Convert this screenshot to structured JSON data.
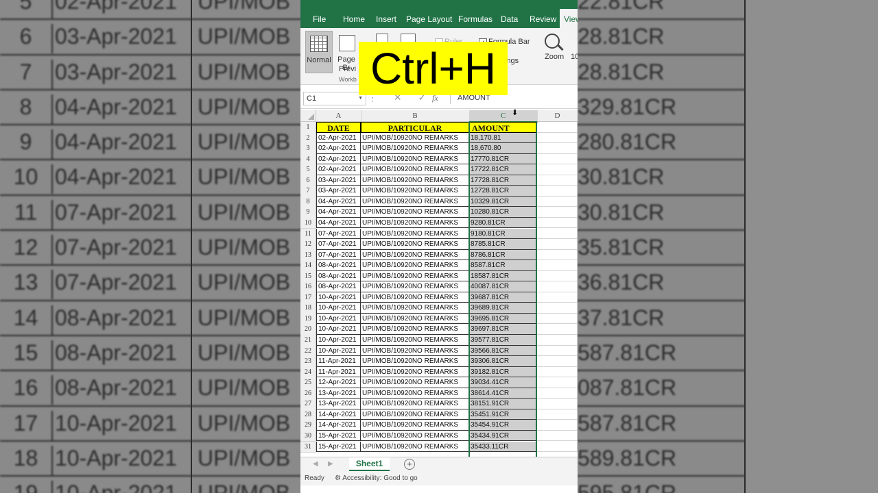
{
  "background": {
    "rows": [
      {
        "num": "5",
        "date": "02-Apr-2021",
        "part": "UPI/MOB",
        "amt": "22.81CR"
      },
      {
        "num": "6",
        "date": "03-Apr-2021",
        "part": "UPI/MOB",
        "amt": "28.81CR"
      },
      {
        "num": "7",
        "date": "03-Apr-2021",
        "part": "UPI/MOB",
        "amt": "28.81CR"
      },
      {
        "num": "8",
        "date": "04-Apr-2021",
        "part": "UPI/MOB",
        "amt": "329.81CR"
      },
      {
        "num": "9",
        "date": "04-Apr-2021",
        "part": "UPI/MOB",
        "amt": "280.81CR"
      },
      {
        "num": "10",
        "date": "04-Apr-2021",
        "part": "UPI/MOB",
        "amt": "30.81CR"
      },
      {
        "num": "11",
        "date": "07-Apr-2021",
        "part": "UPI/MOB",
        "amt": "30.81CR"
      },
      {
        "num": "12",
        "date": "07-Apr-2021",
        "part": "UPI/MOB",
        "amt": "35.81CR"
      },
      {
        "num": "13",
        "date": "07-Apr-2021",
        "part": "UPI/MOB",
        "amt": "36.81CR"
      },
      {
        "num": "14",
        "date": "08-Apr-2021",
        "part": "UPI/MOB",
        "amt": "37.81CR"
      },
      {
        "num": "15",
        "date": "08-Apr-2021",
        "part": "UPI/MOB",
        "amt": "587.81CR"
      },
      {
        "num": "16",
        "date": "08-Apr-2021",
        "part": "UPI/MOB",
        "amt": "087.81CR"
      },
      {
        "num": "17",
        "date": "10-Apr-2021",
        "part": "UPI/MOB",
        "amt": "587.81CR"
      },
      {
        "num": "18",
        "date": "10-Apr-2021",
        "part": "UPI/MOB",
        "amt": "589.81CR"
      },
      {
        "num": "19",
        "date": "10-Apr-2021",
        "part": "UPI/MOB",
        "amt": "595.81CR"
      }
    ]
  },
  "ribbon": {
    "tabs": [
      "File",
      "Home",
      "Insert",
      "Page Layout",
      "Formulas",
      "Data",
      "Review",
      "View"
    ],
    "active_tab": "View",
    "normal_label": "Normal",
    "page_break_label": "Page Br",
    "page_break_label2": "Previ",
    "workbook_group": "Workb",
    "ruler_label": "Ruler",
    "formula_bar_label": "Formula Bar",
    "headings_label": "ings",
    "zoom_label": "Zoom",
    "zoom100_label": "10"
  },
  "overlay": {
    "text": "Ctrl+H"
  },
  "formula_bar": {
    "name_box": "C1",
    "fx": "fx",
    "content": "AMOUNT"
  },
  "columns": [
    "A",
    "B",
    "C",
    "D"
  ],
  "headers": {
    "a": "DATE",
    "b": "PARTICULAR",
    "c": "AMOUNT"
  },
  "rows": [
    {
      "n": "1"
    },
    {
      "n": "2",
      "a": "02-Apr-2021",
      "b": "UPI/MOB/10920NO REMARKS",
      "c": "18,170.81"
    },
    {
      "n": "3",
      "a": "02-Apr-2021",
      "b": "UPI/MOB/10920NO REMARKS",
      "c": "18,670.80"
    },
    {
      "n": "4",
      "a": "02-Apr-2021",
      "b": "UPI/MOB/10920NO REMARKS",
      "c": "17770.81CR"
    },
    {
      "n": "5",
      "a": "02-Apr-2021",
      "b": "UPI/MOB/10920NO REMARKS",
      "c": "17722.81CR"
    },
    {
      "n": "6",
      "a": "03-Apr-2021",
      "b": "UPI/MOB/10920NO REMARKS",
      "c": "17728.81CR"
    },
    {
      "n": "7",
      "a": "03-Apr-2021",
      "b": "UPI/MOB/10920NO REMARKS",
      "c": "12728.81CR"
    },
    {
      "n": "8",
      "a": "04-Apr-2021",
      "b": "UPI/MOB/10920NO REMARKS",
      "c": "10329.81CR"
    },
    {
      "n": "9",
      "a": "04-Apr-2021",
      "b": "UPI/MOB/10920NO REMARKS",
      "c": "10280.81CR"
    },
    {
      "n": "10",
      "a": "04-Apr-2021",
      "b": "UPI/MOB/10920NO REMARKS",
      "c": "9280.81CR"
    },
    {
      "n": "11",
      "a": "07-Apr-2021",
      "b": "UPI/MOB/10920NO REMARKS",
      "c": "9180.81CR"
    },
    {
      "n": "12",
      "a": "07-Apr-2021",
      "b": "UPI/MOB/10920NO REMARKS",
      "c": "8785.81CR"
    },
    {
      "n": "13",
      "a": "07-Apr-2021",
      "b": "UPI/MOB/10920NO REMARKS",
      "c": "8786.81CR"
    },
    {
      "n": "14",
      "a": "08-Apr-2021",
      "b": "UPI/MOB/10920NO REMARKS",
      "c": "8587.81CR"
    },
    {
      "n": "15",
      "a": "08-Apr-2021",
      "b": "UPI/MOB/10920NO REMARKS",
      "c": "18587.81CR"
    },
    {
      "n": "16",
      "a": "08-Apr-2021",
      "b": "UPI/MOB/10920NO REMARKS",
      "c": "40087.81CR"
    },
    {
      "n": "17",
      "a": "10-Apr-2021",
      "b": "UPI/MOB/10920NO REMARKS",
      "c": "39687.81CR"
    },
    {
      "n": "18",
      "a": "10-Apr-2021",
      "b": "UPI/MOB/10920NO REMARKS",
      "c": "39689.81CR"
    },
    {
      "n": "19",
      "a": "10-Apr-2021",
      "b": "UPI/MOB/10920NO REMARKS",
      "c": "39695.81CR"
    },
    {
      "n": "20",
      "a": "10-Apr-2021",
      "b": "UPI/MOB/10920NO REMARKS",
      "c": "39697.81CR"
    },
    {
      "n": "21",
      "a": "10-Apr-2021",
      "b": "UPI/MOB/10920NO REMARKS",
      "c": "39577.81CR"
    },
    {
      "n": "22",
      "a": "10-Apr-2021",
      "b": "UPI/MOB/10920NO REMARKS",
      "c": "39566.81CR"
    },
    {
      "n": "23",
      "a": "11-Apr-2021",
      "b": "UPI/MOB/10920NO REMARKS",
      "c": "39306.81CR"
    },
    {
      "n": "24",
      "a": "11-Apr-2021",
      "b": "UPI/MOB/10920NO REMARKS",
      "c": "39182.81CR"
    },
    {
      "n": "25",
      "a": "12-Apr-2021",
      "b": "UPI/MOB/10920NO REMARKS",
      "c": "39034.41CR"
    },
    {
      "n": "26",
      "a": "13-Apr-2021",
      "b": "UPI/MOB/10920NO REMARKS",
      "c": "38614.41CR"
    },
    {
      "n": "27",
      "a": "13-Apr-2021",
      "b": "UPI/MOB/10920NO REMARKS",
      "c": "38151.91CR"
    },
    {
      "n": "28",
      "a": "14-Apr-2021",
      "b": "UPI/MOB/10920NO REMARKS",
      "c": "35451.91CR"
    },
    {
      "n": "29",
      "a": "14-Apr-2021",
      "b": "UPI/MOB/10920NO REMARKS",
      "c": "35454.91CR"
    },
    {
      "n": "30",
      "a": "15-Apr-2021",
      "b": "UPI/MOB/10920NO REMARKS",
      "c": "35434.91CR"
    },
    {
      "n": "31",
      "a": "15-Apr-2021",
      "b": "UPI/MOB/10920NO REMARKS",
      "c": "35433.11CR"
    }
  ],
  "sheet_tab": "Sheet1",
  "status": {
    "ready": "Ready",
    "accessibility": "Accessibility: Good to go"
  },
  "colors": {
    "excel_green": "#217346",
    "highlight_yellow": "#ffff00",
    "selection_gray": "#cfcfcf"
  }
}
